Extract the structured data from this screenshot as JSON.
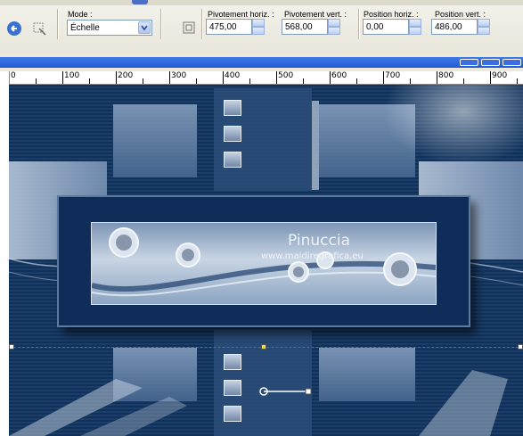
{
  "toolbar": {
    "mode_label": "Mode :",
    "mode_value": "Échelle",
    "pivot_h_label": "Pivotement horiz. :",
    "pivot_h_value": "475,00",
    "pivot_v_label": "Pivotement vert. :",
    "pivot_v_value": "568,00",
    "pos_h_label": "Position horiz. :",
    "pos_h_value": "0,00",
    "pos_v_label": "Position vert. :",
    "pos_v_value": "486,00"
  },
  "ruler": {
    "labels": [
      "0",
      "100",
      "200",
      "300",
      "400",
      "500",
      "600",
      "700",
      "800",
      "900"
    ]
  },
  "canvas": {
    "title": "Pinuccia",
    "website": "www.maidiregrafica.eu"
  },
  "colors": {
    "canvas_bg": "#16375f",
    "selection_line": "#d03a3a",
    "titlebar": "#2d64dc"
  }
}
